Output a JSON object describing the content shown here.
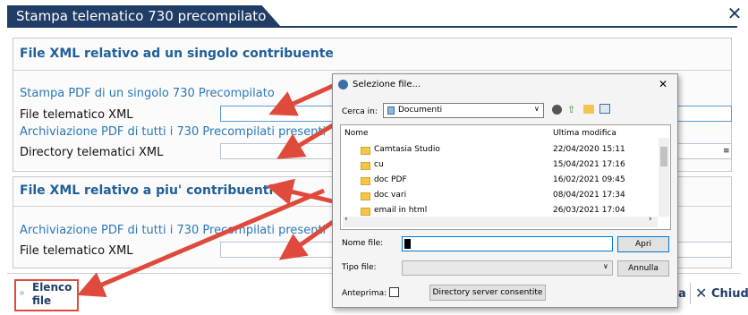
{
  "window": {
    "title": "Stampa telematico 730 precompilato",
    "close_glyph": "✕"
  },
  "section1": {
    "header": "File XML relativo ad un singolo contribuente",
    "link_pdf_single": "Stampa PDF di un singolo 730 Precompilato",
    "label_file_xml": "File telematico XML",
    "link_archive": "Archiviazione PDF di tutti i 730 Precompilati presenti",
    "label_directory": "Directory telematici XML"
  },
  "section2": {
    "header": "File XML relativo a piu' contribuenti",
    "link_archive": "Archiviazione PDF di tutti i 730 Precompilati presenti",
    "label_file_xml": "File telematico XML"
  },
  "bottom": {
    "elenco_file": "Elenco file",
    "stampa_partial": "a",
    "chiudi": "Chiudi"
  },
  "dialog": {
    "title": "Selezione file...",
    "close_glyph": "✕",
    "cerca_in_label": "Cerca in:",
    "cerca_in_value": "Documenti",
    "col_name": "Nome",
    "col_modified": "Ultima modifica",
    "files": [
      {
        "name": "Camtasia Studio",
        "date": "22/04/2020 15:11"
      },
      {
        "name": "cu",
        "date": "15/04/2021 17:16"
      },
      {
        "name": "doc PDF",
        "date": "16/02/2021 09:45"
      },
      {
        "name": "doc vari",
        "date": "08/04/2021 17:34"
      },
      {
        "name": "email in html",
        "date": "26/03/2021 17:04"
      }
    ],
    "nome_file_label": "Nome file:",
    "nome_file_value": "",
    "apri": "Apri",
    "tipo_file_label": "Tipo file:",
    "annulla": "Annulla",
    "anteprima_label": "Anteprima:",
    "directory_server": "Directory server consentite"
  },
  "colors": {
    "title_bg": "#1f3d66",
    "header_blue": "#1f5f99",
    "link_blue": "#2a78b8",
    "arrow_red": "#e04a3c"
  }
}
